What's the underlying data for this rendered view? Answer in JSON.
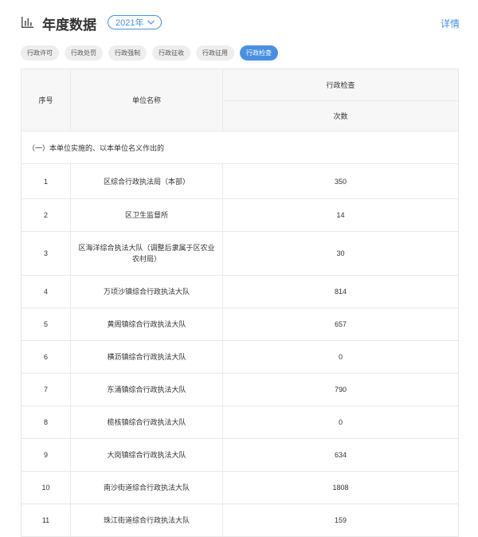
{
  "header": {
    "title": "年度数据",
    "year": "2021年",
    "detail_link": "详情"
  },
  "tabs": [
    {
      "label": "行政许可",
      "active": false
    },
    {
      "label": "行政处罚",
      "active": false
    },
    {
      "label": "行政强制",
      "active": false
    },
    {
      "label": "行政征收",
      "active": false
    },
    {
      "label": "行政征用",
      "active": false
    },
    {
      "label": "行政检查",
      "active": true
    }
  ],
  "table": {
    "col_no": "序号",
    "col_unit": "单位名称",
    "col_group": "行政检查",
    "col_count": "次数",
    "section_title": "（一）本单位实施的、以本单位名义作出的",
    "rows": [
      {
        "no": "1",
        "unit": "区综合行政执法局（本部）",
        "count": "350"
      },
      {
        "no": "2",
        "unit": "区卫生监督所",
        "count": "14"
      },
      {
        "no": "3",
        "unit": "区海洋综合执法大队（调整后隶属于区农业农村局）",
        "count": "30"
      },
      {
        "no": "4",
        "unit": "万顷沙镇综合行政执法大队",
        "count": "814"
      },
      {
        "no": "5",
        "unit": "黄阁镇综合行政执法大队",
        "count": "657"
      },
      {
        "no": "6",
        "unit": "横沥镇综合行政执法大队",
        "count": "0"
      },
      {
        "no": "7",
        "unit": "东涌镇综合行政执法大队",
        "count": "790"
      },
      {
        "no": "8",
        "unit": "榄核镇综合行政执法大队",
        "count": "0"
      },
      {
        "no": "9",
        "unit": "大岗镇综合行政执法大队",
        "count": "634"
      },
      {
        "no": "10",
        "unit": "南沙街道综合行政执法大队",
        "count": "1808"
      },
      {
        "no": "11",
        "unit": "珠江街道综合行政执法大队",
        "count": "159"
      }
    ]
  },
  "colors": {
    "accent": "#4a90e2",
    "tab_inactive_bg": "#eeeeee",
    "border": "#e8e8e8"
  }
}
